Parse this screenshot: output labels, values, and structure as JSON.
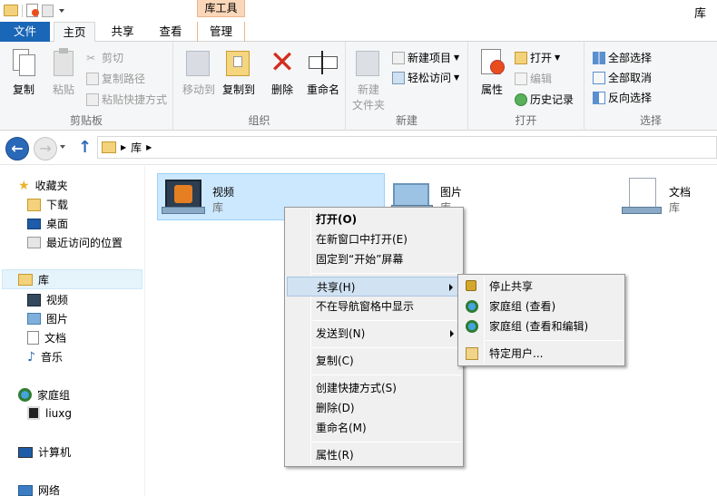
{
  "window": {
    "title": "库",
    "context_tab_header": "库工具"
  },
  "tabs": {
    "file": "文件",
    "home": "主页",
    "share": "共享",
    "view": "查看",
    "manage": "管理"
  },
  "ribbon": {
    "clipboard": {
      "label": "剪贴板",
      "copy": "复制",
      "paste": "粘贴",
      "cut": "剪切",
      "copy_path": "复制路径",
      "paste_shortcut": "粘贴快捷方式"
    },
    "organize": {
      "label": "组织",
      "move_to": "移动到",
      "copy_to": "复制到",
      "delete": "删除",
      "rename": "重命名"
    },
    "new": {
      "label": "新建",
      "new_folder_line1": "新建",
      "new_folder_line2": "文件夹",
      "new_item": "新建项目",
      "easy_access": "轻松访问"
    },
    "open": {
      "label": "打开",
      "properties": "属性",
      "open": "打开",
      "edit": "编辑",
      "history": "历史记录"
    },
    "select": {
      "label": "选择",
      "select_all": "全部选择",
      "select_none": "全部取消",
      "invert": "反向选择"
    }
  },
  "address": {
    "segment": "库"
  },
  "nav": {
    "favorites": "收藏夹",
    "downloads": "下载",
    "desktop": "桌面",
    "recent": "最近访问的位置",
    "libraries": "库",
    "videos": "视频",
    "pictures": "图片",
    "documents": "文档",
    "music": "音乐",
    "homegroup": "家庭组",
    "user": "liuxg",
    "computer": "计算机",
    "network": "网络"
  },
  "items": [
    {
      "name": "视频",
      "sub": "库"
    },
    {
      "name": "图片",
      "sub": "库"
    },
    {
      "name": "文档",
      "sub": "库"
    }
  ],
  "context_menu": {
    "open": "打开(O)",
    "open_new_window": "在新窗口中打开(E)",
    "pin_start": "固定到“开始”屏幕",
    "share": "共享(H)",
    "hide_nav": "不在导航窗格中显示",
    "send_to": "发送到(N)",
    "copy": "复制(C)",
    "create_shortcut": "创建快捷方式(S)",
    "delete": "删除(D)",
    "rename": "重命名(M)",
    "properties": "属性(R)"
  },
  "submenu": {
    "stop_sharing": "停止共享",
    "homegroup_view": "家庭组 (查看)",
    "homegroup_edit": "家庭组 (查看和编辑)",
    "specific_people": "特定用户..."
  }
}
